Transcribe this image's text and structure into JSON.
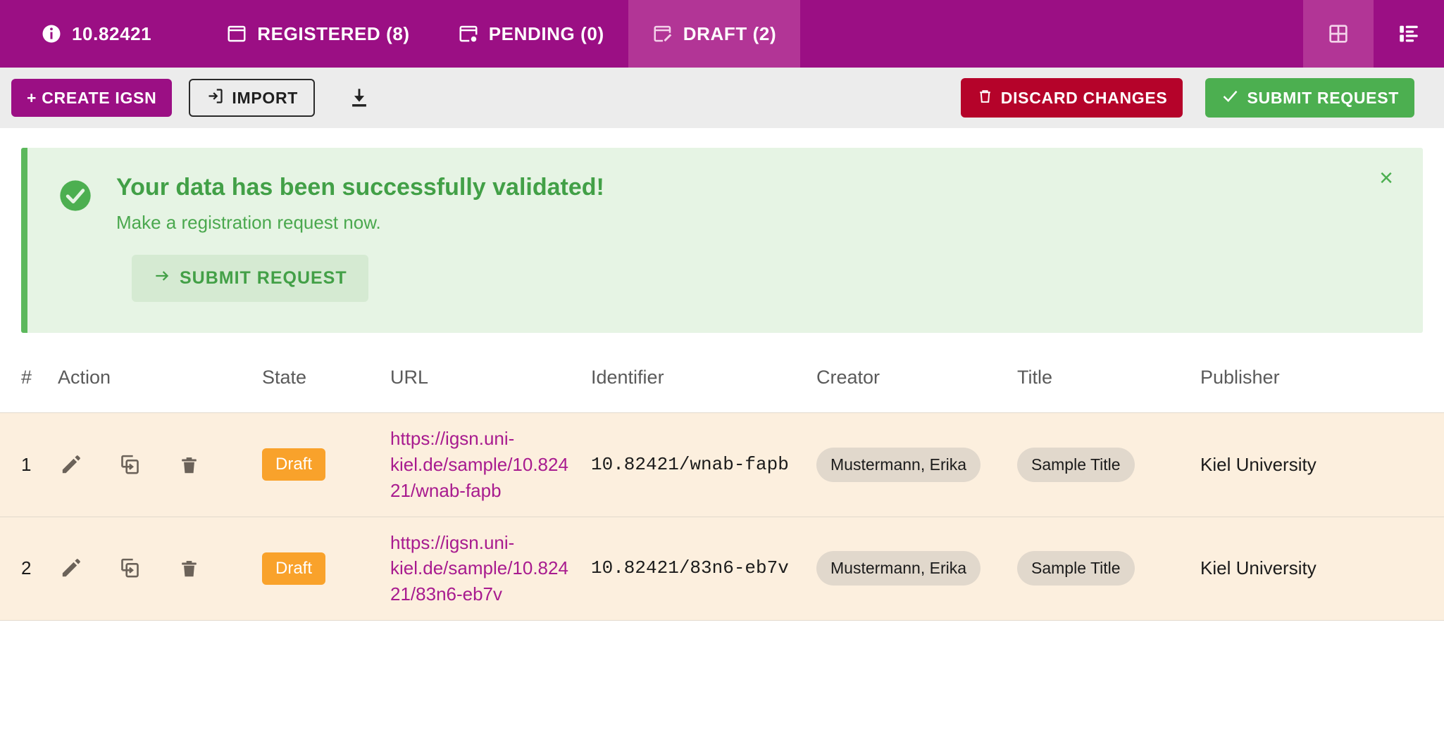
{
  "navbar": {
    "brand": "10.82421",
    "brand_icon": "info-circle-icon",
    "tabs": [
      {
        "label": "REGISTERED (8)",
        "icon": "registered-window-icon",
        "active": false
      },
      {
        "label": "PENDING (0)",
        "icon": "pending-gear-window-icon",
        "active": false
      },
      {
        "label": "DRAFT (2)",
        "icon": "draft-pencil-window-icon",
        "active": true
      }
    ],
    "view_buttons": [
      {
        "name": "table-view-icon",
        "tinted": true
      },
      {
        "name": "list-view-icon",
        "tinted": false
      }
    ],
    "colors": {
      "bar": "#9b0f84",
      "active_tab": "#b23596",
      "text": "#ffffff"
    }
  },
  "toolbar": {
    "create_label": "+ CREATE IGSN",
    "import_label": "IMPORT",
    "import_icon": "import-arrow-icon",
    "download_icon": "download-icon",
    "discard_label": "DISCARD CHANGES",
    "discard_icon": "trash-icon",
    "submit_label": "SUBMIT REQUEST",
    "submit_icon": "check-icon",
    "colors": {
      "background": "#ececec",
      "create": "#9b0f84",
      "discard": "#b5032a",
      "submit": "#4caf50"
    }
  },
  "alert": {
    "icon": "success-check-circle-icon",
    "title": "Your data has been successfully validated!",
    "subtitle": "Make a registration request now.",
    "action_label": "SUBMIT REQUEST",
    "action_icon": "arrow-right-icon",
    "close_label": "×",
    "colors": {
      "background": "#e6f4e4",
      "border": "#5cb85c",
      "text": "#42a047",
      "button_background": "#d5ead2"
    }
  },
  "table": {
    "columns": [
      "#",
      "Action",
      "State",
      "URL",
      "Identifier",
      "Creator",
      "Title",
      "Publisher"
    ],
    "row_actions": [
      {
        "name": "edit-icon",
        "title": "Edit"
      },
      {
        "name": "duplicate-icon",
        "title": "Duplicate"
      },
      {
        "name": "delete-icon",
        "title": "Delete"
      }
    ],
    "rows": [
      {
        "num": "1",
        "state": "Draft",
        "url": "https://igsn.uni-kiel.de/sample/10.82421/wnab-fapb",
        "identifier": "10.82421/wnab-fapb",
        "creator": "Mustermann, Erika",
        "title": "Sample Title",
        "publisher": "Kiel University"
      },
      {
        "num": "2",
        "state": "Draft",
        "url": "https://igsn.uni-kiel.de/sample/10.82421/83n6-eb7v",
        "identifier": "10.82421/83n6-eb7v",
        "creator": "Mustermann, Erika",
        "title": "Sample Title",
        "publisher": "Kiel University"
      }
    ],
    "colors": {
      "row_background": "#fcefde",
      "badge": "#f9a22b",
      "link": "#a81b8f",
      "chip": "#e1d8cc",
      "header_text": "#5a5a5a"
    }
  }
}
